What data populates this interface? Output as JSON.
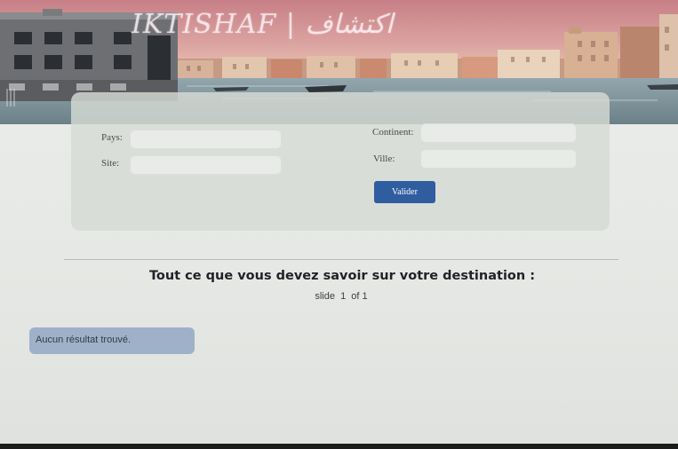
{
  "header": {
    "site_title": "IKTISHAF | اكتشاف"
  },
  "search_form": {
    "country_label": "Pays:",
    "site_label": "Site:",
    "continent_label": "Continent:",
    "city_label": "Ville:",
    "country_value": "",
    "site_value": "",
    "continent_value": "",
    "city_value": "",
    "submit_label": "Valider"
  },
  "main": {
    "heading": "Tout ce que vous devez savoir sur votre destination :",
    "slide_indicator": "slide  1  of 1"
  },
  "results": {
    "empty_message": "Aucun résultat trouvé."
  },
  "colors": {
    "button": "#2f5da0",
    "no_result_background": "#9fb1c9"
  }
}
